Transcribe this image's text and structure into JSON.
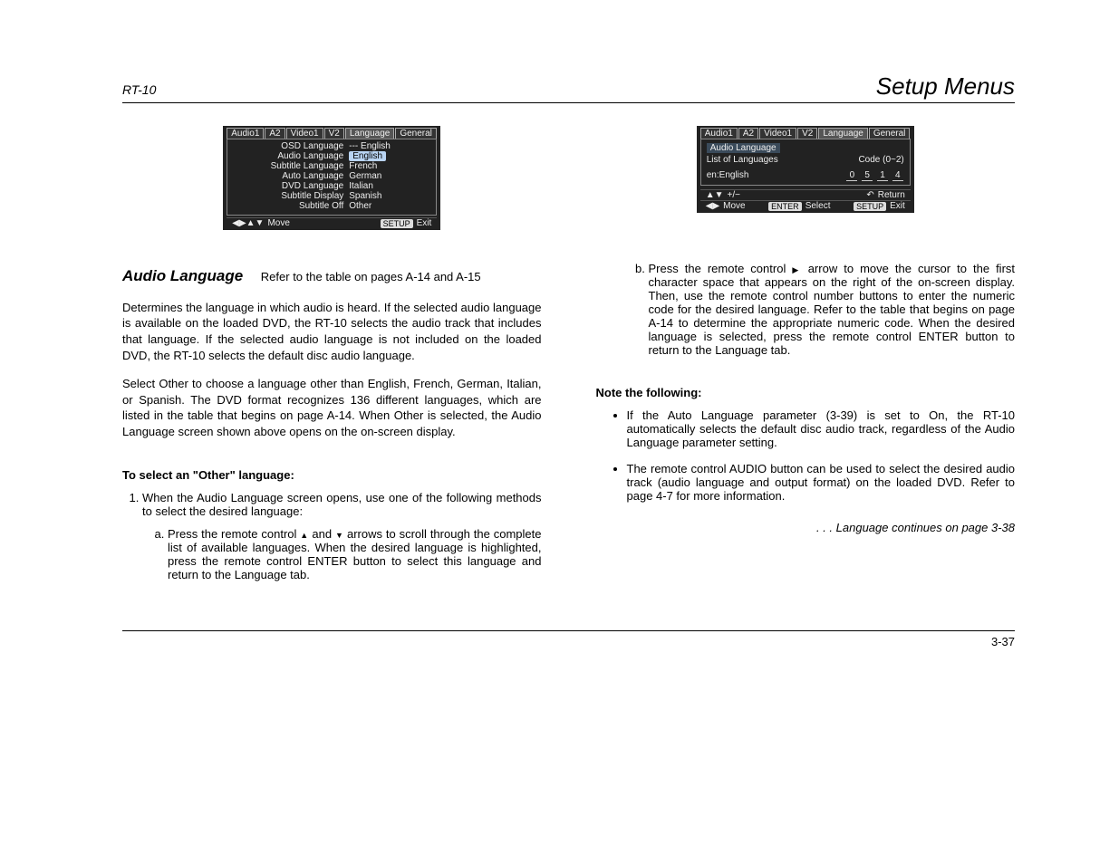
{
  "header": {
    "left": "RT-10",
    "right": "Setup Menus"
  },
  "osd_left": {
    "tabs": [
      "Audio1",
      "A2",
      "Video1",
      "V2",
      "Language",
      "General"
    ],
    "selected_tab": "Language",
    "rows": [
      {
        "label": "OSD Language",
        "value": "--- English",
        "hl": false
      },
      {
        "label": "Audio Language",
        "value": "English",
        "hl": true
      },
      {
        "label": "Subtitle Language",
        "value": "French",
        "hl": false
      },
      {
        "label": "Auto Language",
        "value": "German",
        "hl": false
      },
      {
        "label": "DVD Language",
        "value": "Italian",
        "hl": false
      },
      {
        "label": "Subtitle Display",
        "value": "Spanish",
        "hl": false
      },
      {
        "label": "Subtitle Off",
        "value": "Other",
        "hl": false
      }
    ],
    "foot": {
      "left_arrows": "◀▶▲▼",
      "left_label": "Move",
      "right_pill": "SETUP",
      "right_label": "Exit"
    }
  },
  "osd_right": {
    "tabs": [
      "Audio1",
      "A2",
      "Video1",
      "V2",
      "Language",
      "General"
    ],
    "selected_tab": "Language",
    "sub": {
      "title": "Audio Language",
      "list_label": "List of Languages",
      "code_label": "Code (0~2)",
      "en_label": "en:English",
      "codes": [
        "0",
        "5",
        "1",
        "4"
      ]
    },
    "foot": {
      "r1_left_icon": "▲▼",
      "r1_left_label": "+/−",
      "r1_right_icon": "↶",
      "r1_right_label": "Return",
      "r2_left_icon": "◀▶",
      "r2_left_label": "Move",
      "r2_mid_pill": "ENTER",
      "r2_mid_label": "Select",
      "r2_right_pill": "SETUP",
      "r2_right_label": "Exit"
    }
  },
  "section": {
    "title": "Audio Language",
    "subtitle": "Refer to the table on pages A-14 and A-15"
  },
  "left_col": {
    "p1": "Determines the language in which audio is heard. If the selected audio language is available on the loaded DVD, the RT-10 selects the audio track that includes that language. If the selected audio language is not included on the loaded DVD, the RT-10 selects the default disc audio language.",
    "p2": "Select Other to choose a language other than English, French, German, Italian, or Spanish. The DVD format recognizes 136 different languages, which are listed in the table that begins on page A-14. When Other is selected, the Audio Language screen shown above opens on the on-screen display.",
    "heading2": "To select an \"Other\" language:",
    "step1_intro": "When the Audio Language screen opens, use one of the following methods to select the desired language:",
    "step1a_pre": "Press the remote control ",
    "step1a_post": " arrows to scroll through the complete list of available languages. When the desired language is highlighted, press the remote control ENTER button to select this language and return to the Language tab."
  },
  "right_col": {
    "step1b_pre": "Press the remote control ",
    "step1b_post": " arrow to move the cursor to the first character space that appears on the right of the on-screen display. Then, use the remote control number buttons to enter the numeric code for the desired language. Refer to the table that begins on page A-14 to determine the appropriate numeric code. When the desired language is selected, press the remote control ENTER button to return to the Language tab.",
    "note_heading": "Note the following:",
    "bullet1": "If the Auto Language parameter (3-39) is set to On, the RT-10 automatically selects the default disc audio track, regardless of the Audio Language parameter setting.",
    "bullet2": "The remote control AUDIO button can be used to select the desired audio track (audio language and output format) on the loaded DVD. Refer to page 4-7 for more information.",
    "continues": ". . . Language continues on page 3-38"
  },
  "footer": {
    "page": "3-37"
  }
}
